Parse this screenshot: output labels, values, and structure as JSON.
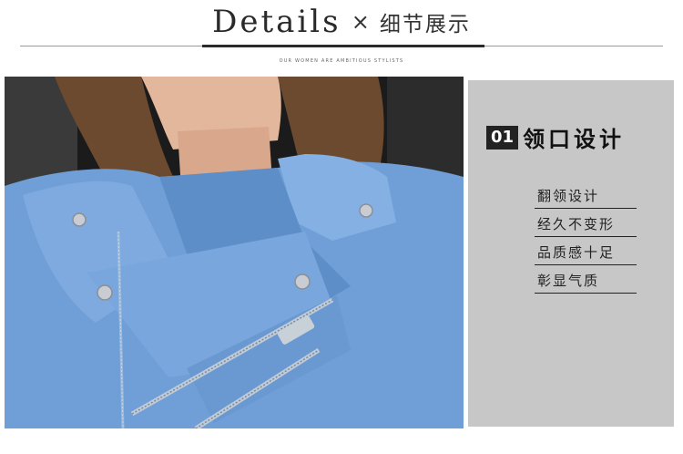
{
  "header": {
    "title_en": "Details",
    "separator": "×",
    "title_cn": "细节展示",
    "tagline": "OUR WOMEN ARE AMBITIOUS STYLISTS"
  },
  "panel": {
    "number": "01",
    "title": "领口设计",
    "features": [
      "翻领设计",
      "经久不变形",
      "品质感十足",
      "彰显气质"
    ]
  },
  "colors": {
    "panel_bg": "#c7c7c7",
    "jacket_blue": "#6f9fd6",
    "badge_bg": "#222222"
  }
}
